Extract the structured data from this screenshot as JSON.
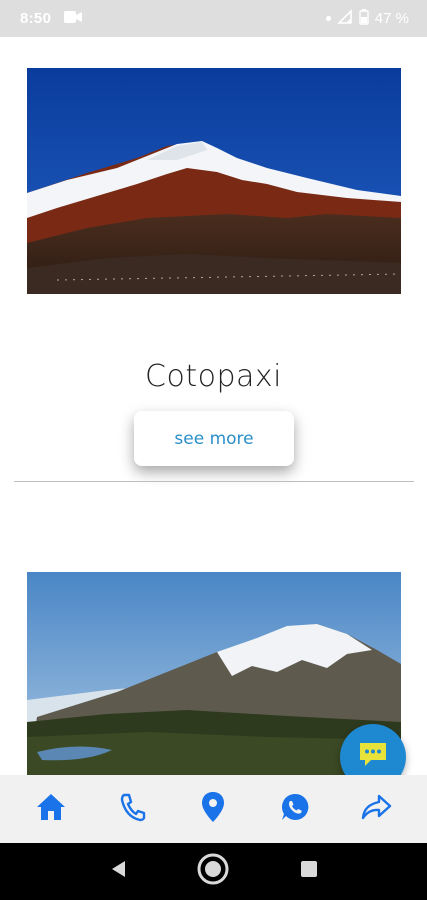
{
  "status_bar": {
    "time": "8:50",
    "battery": "47 %"
  },
  "cards": [
    {
      "title": "Cotopaxi",
      "button_label": "see more"
    },
    {
      "title": "",
      "button_label": ""
    }
  ],
  "bottom_nav": {
    "items": [
      "home-icon",
      "phone-icon",
      "location-pin-icon",
      "whatsapp-icon",
      "share-icon"
    ],
    "color": "#1a73e8"
  },
  "fab": {
    "icon": "chat-icon",
    "color": "#1e88d0"
  },
  "system_nav": [
    "back-icon",
    "home-circle-icon",
    "recents-icon"
  ]
}
